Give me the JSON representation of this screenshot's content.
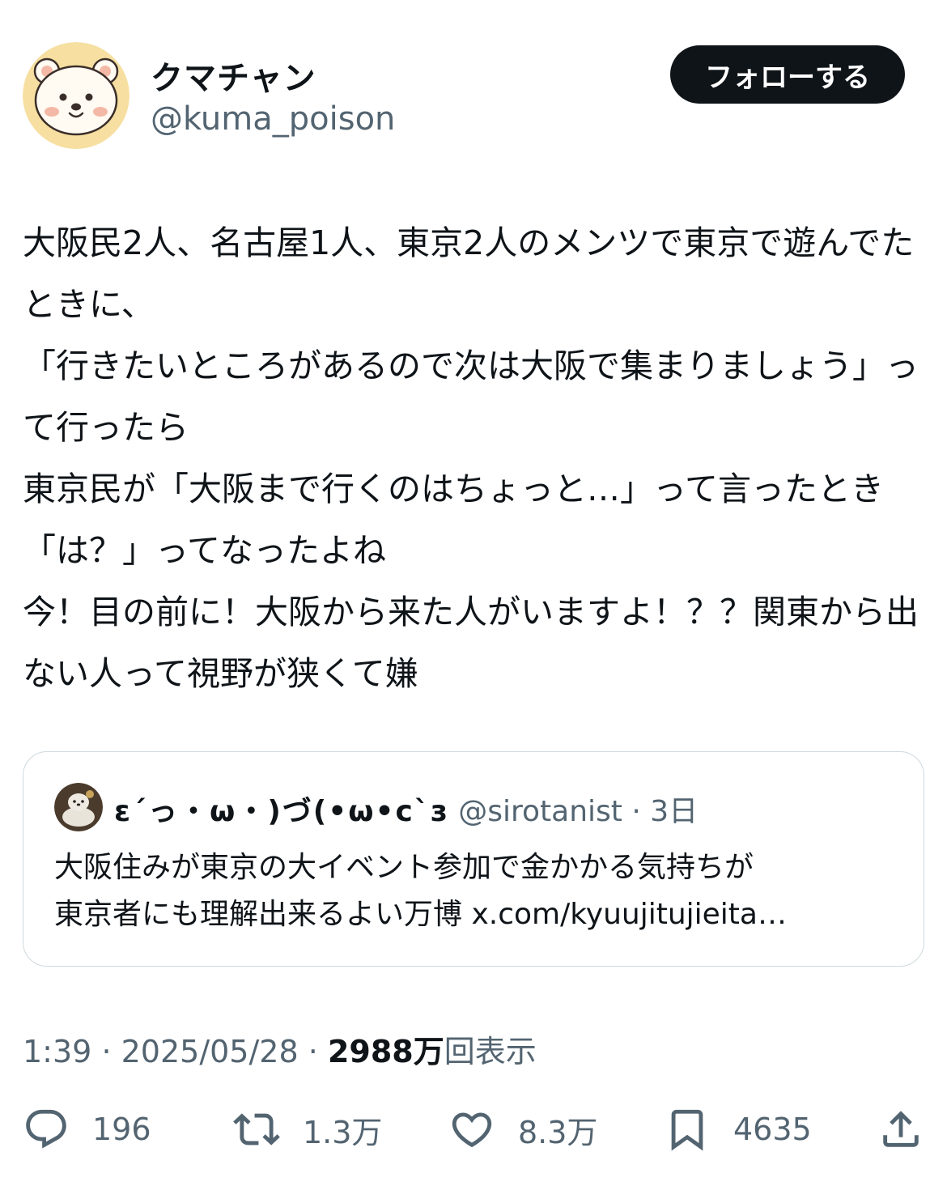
{
  "author": {
    "display_name": "クマチャン",
    "handle": "@kuma_poison",
    "avatar_icon": "bear-avatar-icon"
  },
  "follow_button": {
    "label": "フォローする"
  },
  "tweet": {
    "text": "大阪民2人、名古屋1人、東京2人のメンツで東京で遊んでたときに、\n「行きたいところがあるので次は大阪で集まりましょう」って行ったら\n東京民が「大阪まで行くのはちょっと…」って言ったとき「は？」ってなったよね\n今！目の前に！大阪から来た人がいますよ！？？関東から出ない人って視野が狭くて嫌"
  },
  "quote": {
    "display_name": "ε´っ・ω・)づ(•ω•c`з",
    "handle": "@sirotanist",
    "separator": "·",
    "time": "3日",
    "text": "大阪住みが東京の大イベント参加で金かかる気持ちが\n東京者にも理解出来るよい万博 x.com/kyuujitujieita…"
  },
  "meta": {
    "time": "1:39",
    "separator": "·",
    "date": "2025/05/28",
    "views_count": "2988万",
    "views_label": "回表示"
  },
  "actions": {
    "reply": {
      "count": "196",
      "icon": "reply-icon"
    },
    "retweet": {
      "count": "1.3万",
      "icon": "retweet-icon"
    },
    "like": {
      "count": "8.3万",
      "icon": "heart-icon"
    },
    "bookmark": {
      "count": "4635",
      "icon": "bookmark-icon"
    },
    "share": {
      "icon": "share-icon"
    }
  },
  "colors": {
    "text_primary": "#0f1419",
    "text_secondary": "#536471",
    "border": "#cfd9de",
    "follow_bg": "#0f1419"
  }
}
